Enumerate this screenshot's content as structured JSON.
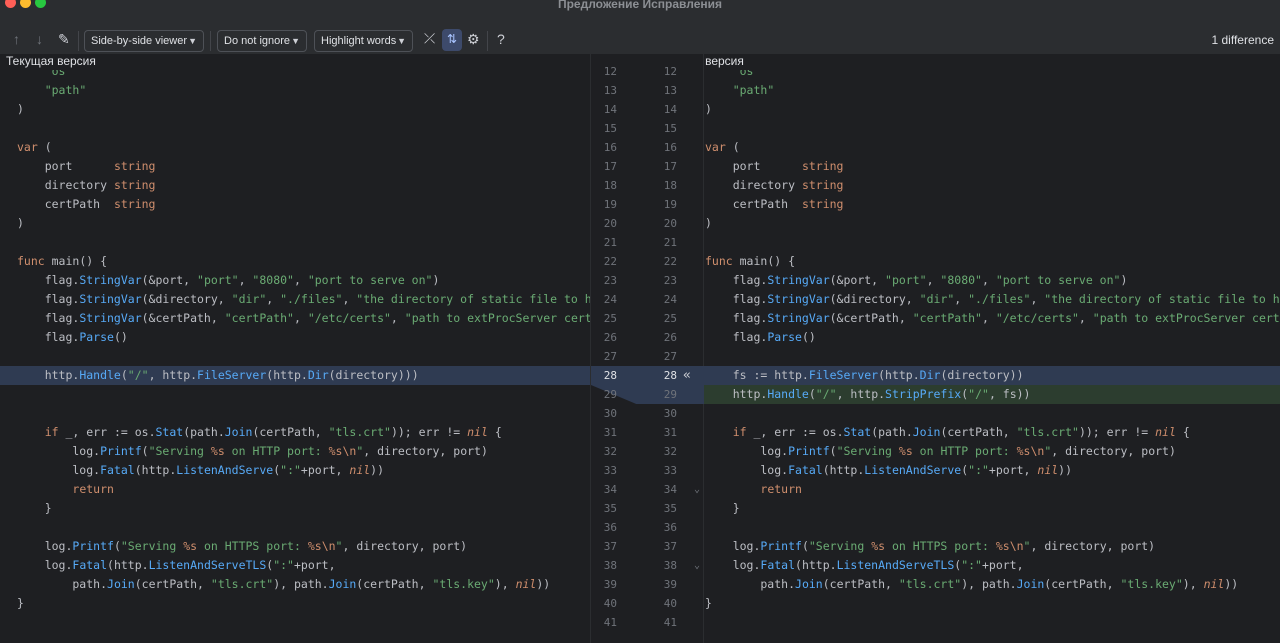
{
  "window": {
    "title": "Предложение Исправления"
  },
  "toolbar": {
    "viewer_mode": "Side-by-side viewer",
    "ignore_mode": "Do not ignore",
    "highlight_mode": "Highlight words",
    "difference_count": "1 difference",
    "icons": [
      "arrow-up-icon",
      "arrow-down-icon",
      "edit-icon",
      "collapse-icon",
      "sync-scroll-icon",
      "gear-icon",
      "help-icon"
    ]
  },
  "left_pane": {
    "header": "Текущая версия",
    "lines": [
      "    \"os\"",
      "    \"path\"",
      ")",
      "",
      "var (",
      "    port      string",
      "    directory string",
      "    certPath  string",
      ")",
      "",
      "func main() {",
      "    flag.StringVar(&port, \"port\", \"8080\", \"port to serve on\")",
      "    flag.StringVar(&directory, \"dir\", \"./files\", \"the directory of static file to host\")",
      "    flag.StringVar(&certPath, \"certPath\", \"/etc/certs\", \"path to extProcServer certificate\")",
      "    flag.Parse()",
      "",
      "    http.Handle(\"/\", http.FileServer(http.Dir(directory)))",
      "",
      "    if _, err := os.Stat(path.Join(certPath, \"tls.crt\")); err != nil {",
      "        log.Printf(\"Serving %s on HTTP port: %s\\n\", directory, port)",
      "        log.Fatal(http.ListenAndServe(\":\"+port, nil))",
      "        return",
      "    }",
      "",
      "    log.Printf(\"Serving %s on HTTPS port: %s\\n\", directory, port)",
      "    log.Fatal(http.ListenAndServeTLS(\":\"+port,",
      "        path.Join(certPath, \"tls.crt\"), path.Join(certPath, \"tls.key\"), nil))",
      "}"
    ]
  },
  "right_pane": {
    "header": "Новая версия",
    "lines": [
      "    \"os\"",
      "    \"path\"",
      ")",
      "",
      "var (",
      "    port      string",
      "    directory string",
      "    certPath  string",
      ")",
      "",
      "func main() {",
      "    flag.StringVar(&port, \"port\", \"8080\", \"port to serve on\")",
      "    flag.StringVar(&directory, \"dir\", \"./files\", \"the directory of static file to host\")",
      "    flag.StringVar(&certPath, \"certPath\", \"/etc/certs\", \"path to extProcServer certificate\")",
      "    flag.Parse()",
      "",
      "    fs := http.FileServer(http.Dir(directory))",
      "    http.Handle(\"/\", http.StripPrefix(\"/\", fs))",
      "",
      "    if _, err := os.Stat(path.Join(certPath, \"tls.crt\")); err != nil {",
      "        log.Printf(\"Serving %s on HTTP port: %s\\n\", directory, port)",
      "        log.Fatal(http.ListenAndServe(\":\"+port, nil))",
      "        return",
      "    }",
      "",
      "    log.Printf(\"Serving %s on HTTPS port: %s\\n\", directory, port)",
      "    log.Fatal(http.ListenAndServeTLS(\":\"+port,",
      "        path.Join(certPath, \"tls.crt\"), path.Join(certPath, \"tls.key\"), nil))",
      "}"
    ]
  },
  "gutter": {
    "left_numbers": [
      "12",
      "13",
      "14",
      "15",
      "16",
      "17",
      "18",
      "19",
      "20",
      "21",
      "22",
      "23",
      "24",
      "25",
      "26",
      "27",
      "28",
      "29",
      "30",
      "31",
      "32",
      "33",
      "34",
      "35",
      "36",
      "37",
      "38",
      "39",
      "40",
      "41"
    ],
    "right_numbers": [
      "12",
      "13",
      "14",
      "15",
      "16",
      "17",
      "18",
      "19",
      "20",
      "21",
      "22",
      "23",
      "24",
      "25",
      "26",
      "27",
      "28",
      "29",
      "30",
      "31",
      "32",
      "33",
      "34",
      "35",
      "36",
      "37",
      "38",
      "39",
      "40",
      "41"
    ],
    "apply_change_glyph": "«",
    "fold_glyph": "⌄"
  }
}
